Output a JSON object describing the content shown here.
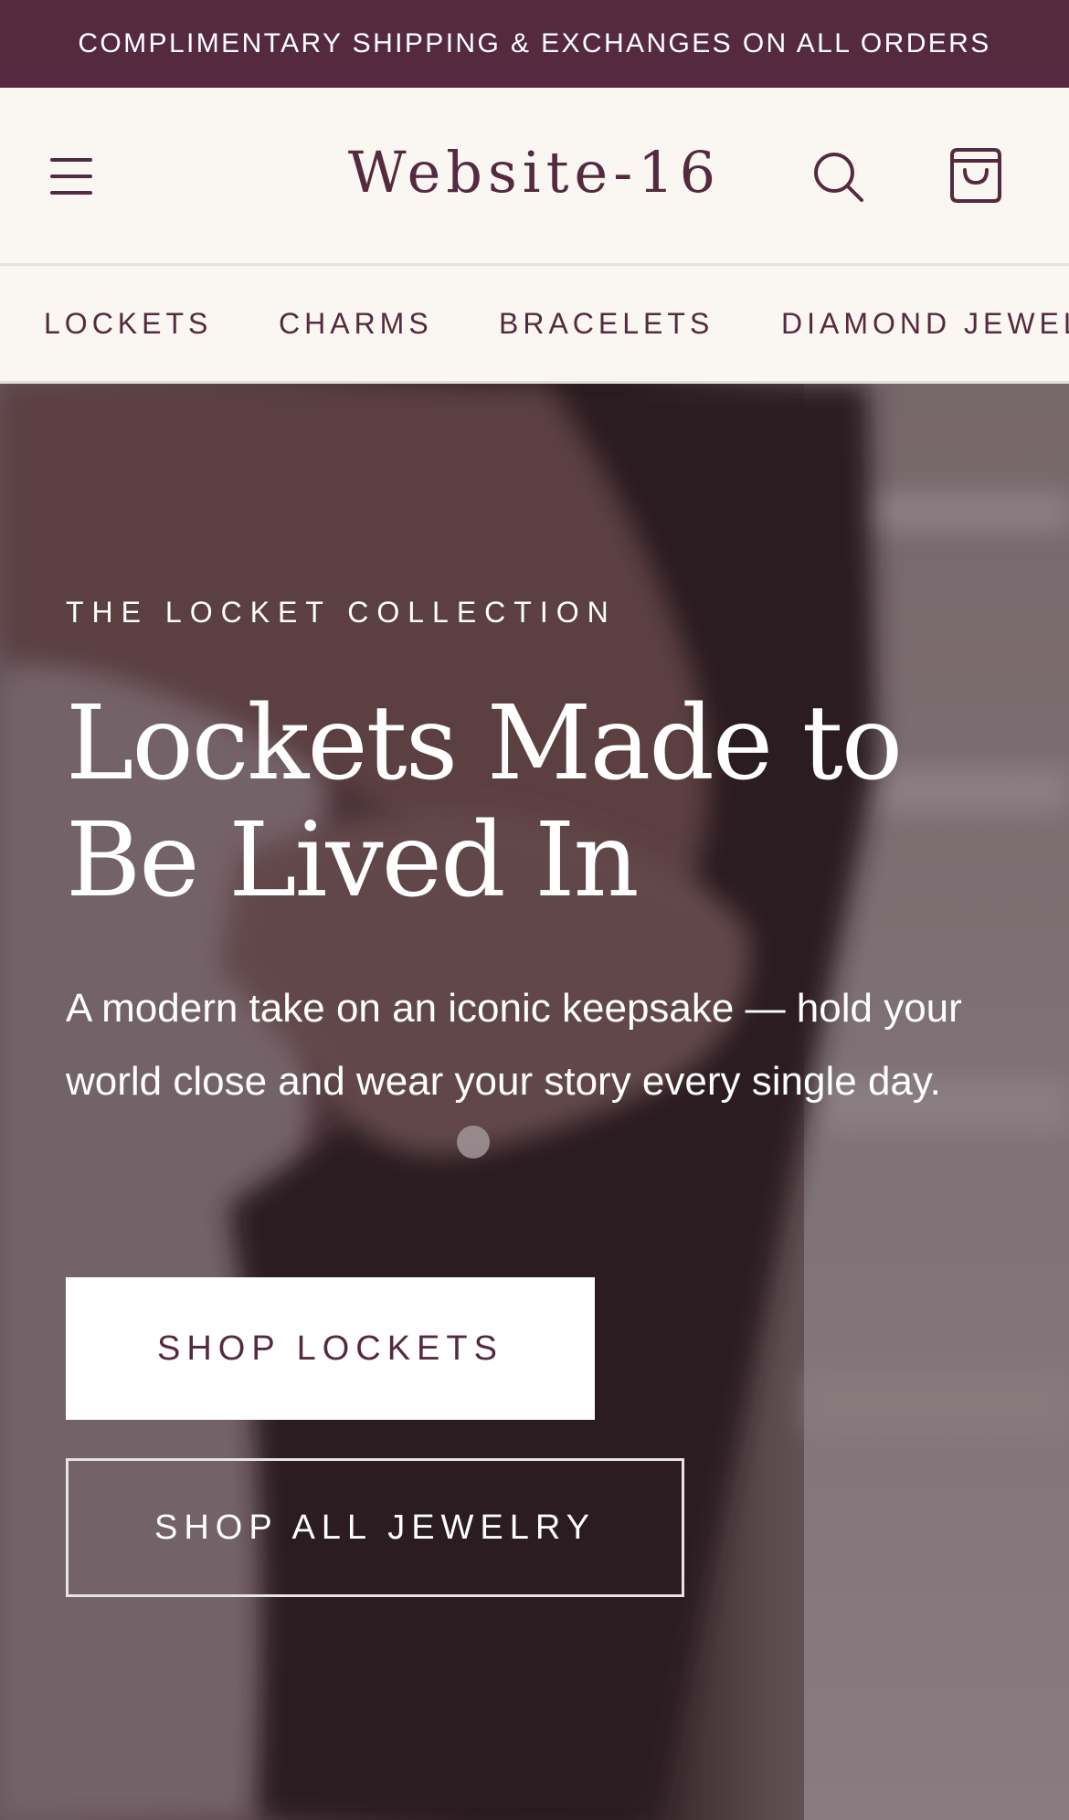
{
  "announcement": {
    "text": "COMPLIMENTARY SHIPPING & EXCHANGES ON ALL ORDERS"
  },
  "header": {
    "logo": "Website-16",
    "menu_icon": "hamburger-menu-icon",
    "search_icon": "search-icon",
    "cart_icon": "shopping-bag-icon"
  },
  "category_nav": {
    "items": [
      {
        "label": "LOCKETS"
      },
      {
        "label": "CHARMS"
      },
      {
        "label": "BRACELETS"
      },
      {
        "label": "DIAMOND JEWELRY"
      }
    ]
  },
  "hero": {
    "eyebrow": "THE LOCKET COLLECTION",
    "headline": "Lockets Made to Be Lived In",
    "subcopy": "A modern take on an iconic keepsake — hold your world close and wear your story every single day.",
    "primary_cta": "SHOP LOCKETS",
    "secondary_cta": "SHOP ALL JEWELRY"
  },
  "colors": {
    "brand": "#552a40",
    "background": "#faf6f2",
    "hero_text": "#ffffff"
  }
}
